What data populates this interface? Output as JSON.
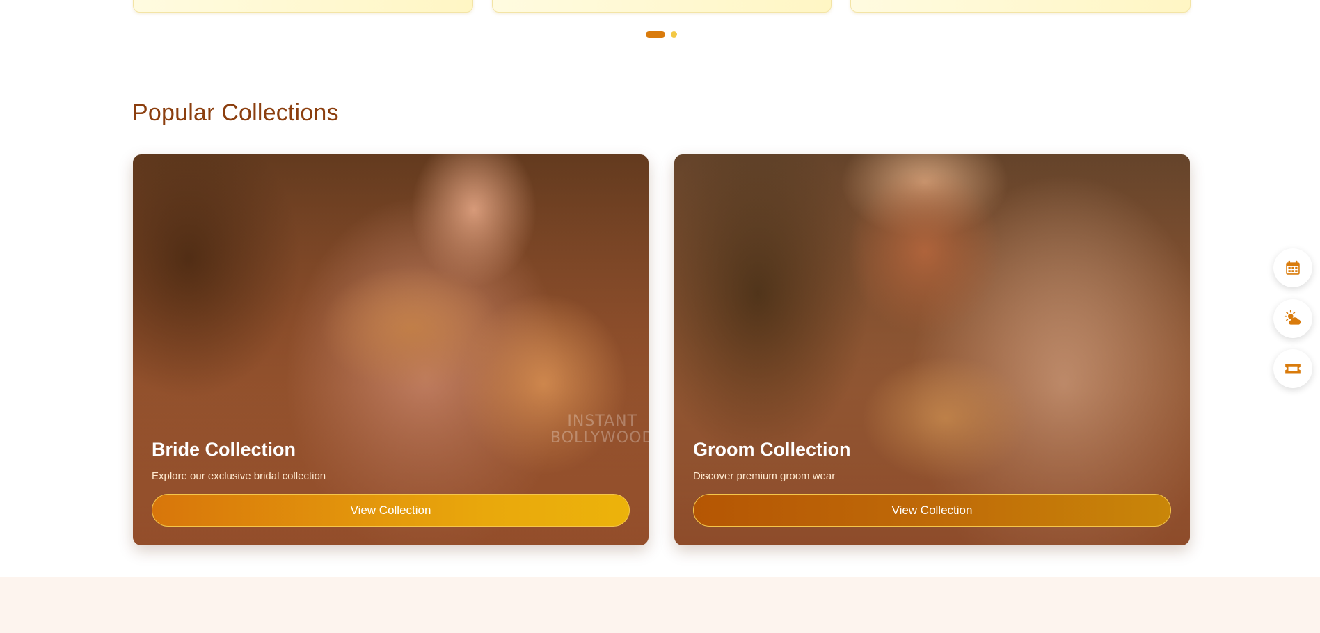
{
  "section": {
    "title": "Popular Collections"
  },
  "carousel": {
    "dots": 2,
    "active_index": 0
  },
  "collections": [
    {
      "title": "Bride Collection",
      "description": "Explore our exclusive bridal collection",
      "button_label": "View Collection",
      "watermark": [
        "INSTANT",
        "BOLLYWOOD"
      ]
    },
    {
      "title": "Groom Collection",
      "description": "Discover premium groom wear",
      "button_label": "View Collection"
    }
  ],
  "side_actions": [
    {
      "icon": "calendar-icon"
    },
    {
      "icon": "weather-sun-cloud-icon"
    },
    {
      "icon": "ticket-icon"
    }
  ],
  "colors": {
    "title": "#8b3e0e",
    "accent": "#d97b0c",
    "accent_light": "#f3c845",
    "bottom_band": "#fdf4ee"
  }
}
